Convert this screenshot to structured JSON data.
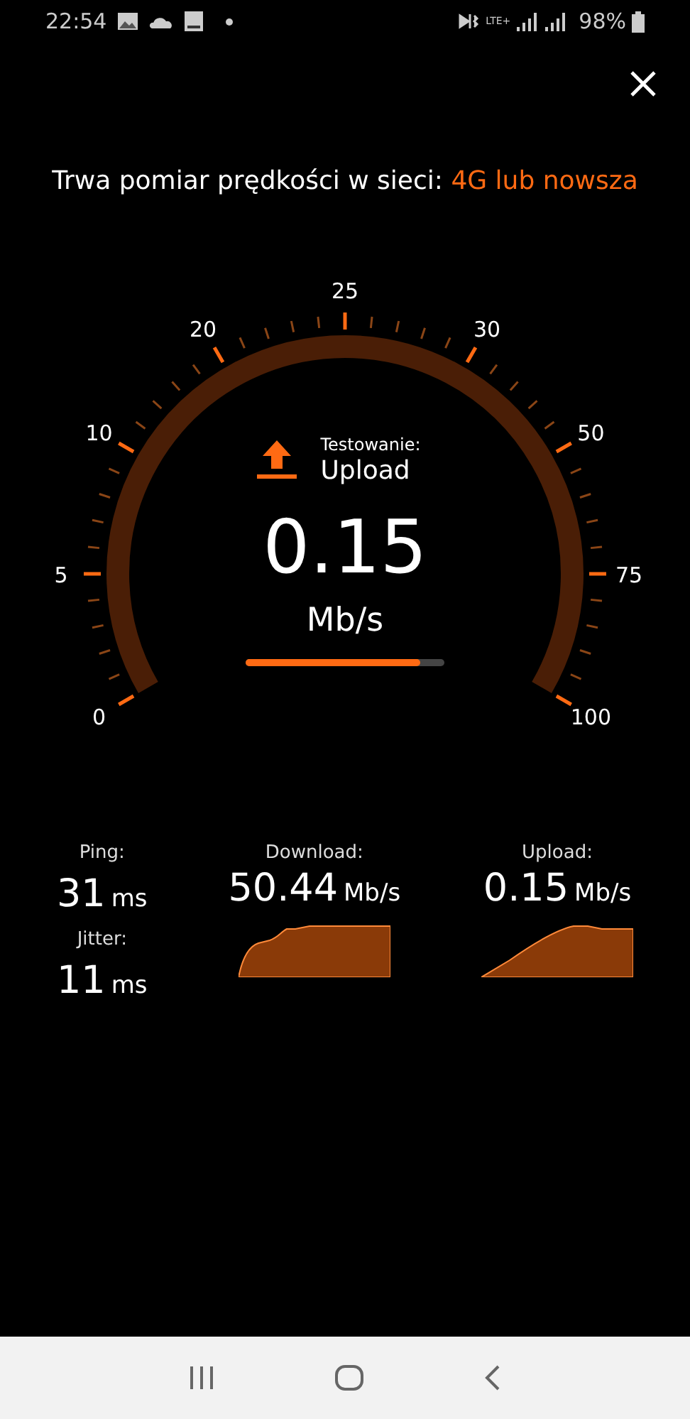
{
  "status_bar": {
    "time": "22:54",
    "network": "LTE+",
    "battery": "98%"
  },
  "title": {
    "text": "Trwa pomiar prędkości w sieci: ",
    "highlight": "4G lub nowsza"
  },
  "gauge": {
    "scale": [
      "0",
      "5",
      "10",
      "20",
      "25",
      "30",
      "50",
      "75",
      "100"
    ],
    "phase_label": "Testowanie:",
    "phase": "Upload",
    "speed": "0.15",
    "unit": "Mb/s",
    "progress": {
      "level": 0.88
    }
  },
  "latency": [
    {
      "label": "Ping:",
      "value": "31",
      "unit": "ms"
    },
    {
      "label": "Jitter:",
      "value": "11",
      "unit": "ms"
    }
  ],
  "speeds": [
    {
      "label": "Download:",
      "value": "50.44",
      "unit": "Mb/s"
    },
    {
      "label": "Upload:",
      "value": "0.15",
      "unit": "Mb/s"
    }
  ]
}
